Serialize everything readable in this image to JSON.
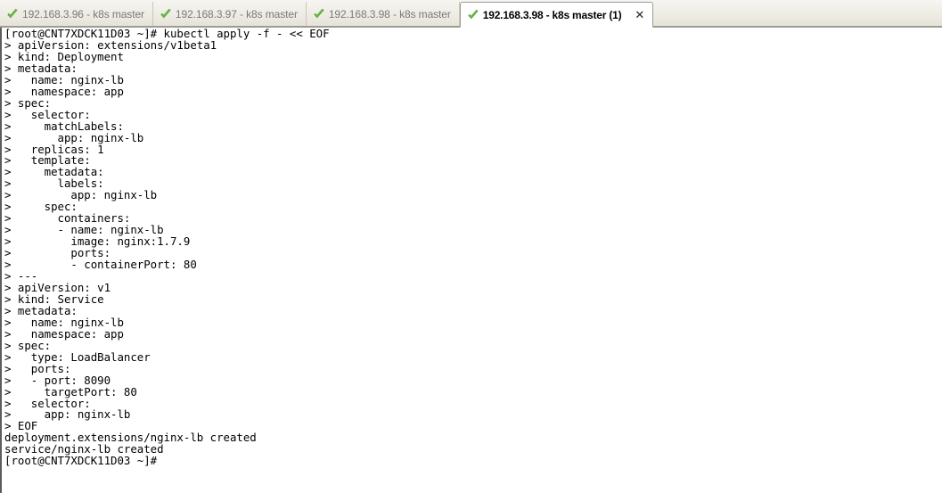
{
  "window": {
    "title": "192.168.3.98 - k8s master (1)"
  },
  "tabbar": {
    "tabs": [
      {
        "label": "192.168.3.96 - k8s master",
        "icon": "green-check-icon",
        "active": false
      },
      {
        "label": "192.168.3.97 - k8s master",
        "icon": "green-check-icon",
        "active": false
      },
      {
        "label": "192.168.3.98 - k8s master",
        "icon": "green-check-icon",
        "active": false
      },
      {
        "label": "192.168.3.98 - k8s master (1)",
        "icon": "green-check-icon",
        "active": true,
        "close_label": "×"
      }
    ],
    "close_label": "✕",
    "colors": {
      "check_green": "#6abf40",
      "active_tab_bg": "#ffffff",
      "inactive_text": "#7a7a7a",
      "bar_bg": "#eeece4"
    }
  },
  "terminal": {
    "prompt": "[root@CNT7XDCK11D03 ~]#",
    "continuation_prompt": ">",
    "colors": {
      "background": "#ffffff",
      "foreground": "#000000"
    },
    "lines": [
      "[root@CNT7XDCK11D03 ~]# kubectl apply -f - << EOF",
      "> apiVersion: extensions/v1beta1",
      "> kind: Deployment",
      "> metadata:",
      ">   name: nginx-lb",
      ">   namespace: app",
      "> spec:",
      ">   selector:",
      ">     matchLabels:",
      ">       app: nginx-lb",
      ">   replicas: 1",
      ">   template:",
      ">     metadata:",
      ">       labels:",
      ">         app: nginx-lb",
      ">     spec:",
      ">       containers:",
      ">       - name: nginx-lb",
      ">         image: nginx:1.7.9",
      ">         ports:",
      ">         - containerPort: 80",
      "> ---",
      "> apiVersion: v1",
      "> kind: Service",
      "> metadata:",
      ">   name: nginx-lb",
      ">   namespace: app",
      "> spec:",
      ">   type: LoadBalancer",
      ">   ports:",
      ">   - port: 8090",
      ">     targetPort: 80",
      ">   selector:",
      ">     app: nginx-lb",
      "> EOF",
      "deployment.extensions/nginx-lb created",
      "service/nginx-lb created",
      "[root@CNT7XDCK11D03 ~]#"
    ]
  }
}
